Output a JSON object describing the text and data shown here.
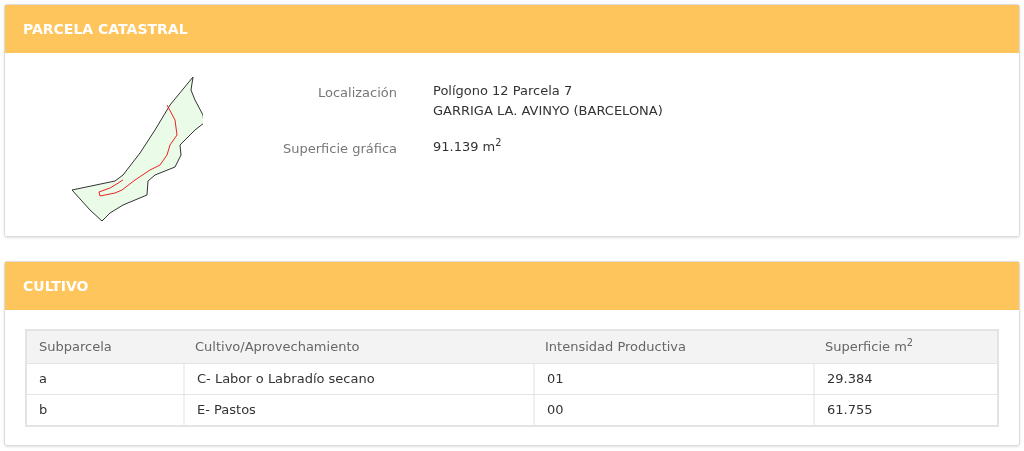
{
  "parcel": {
    "title": "PARCELA CATASTRAL",
    "fields": [
      {
        "label": "Localización",
        "lines": [
          "Polígono 12 Parcela 7",
          "GARRIGA LA. AVINYO (BARCELONA)"
        ]
      },
      {
        "label": "Superficie gráfica",
        "lines": [
          "91.139 m$^{2}$"
        ]
      }
    ]
  },
  "crops": {
    "title": "CULTIVO",
    "columns": [
      "Subparcela",
      "Cultivo/Aprovechamiento",
      "Intensidad Productiva",
      "Superficie m$^{2}$"
    ],
    "rows": [
      [
        "a",
        "C- Labor o Labradío secano",
        "01",
        "29.384"
      ],
      [
        "b",
        "E- Pastos",
        "00",
        "61.755"
      ]
    ]
  }
}
